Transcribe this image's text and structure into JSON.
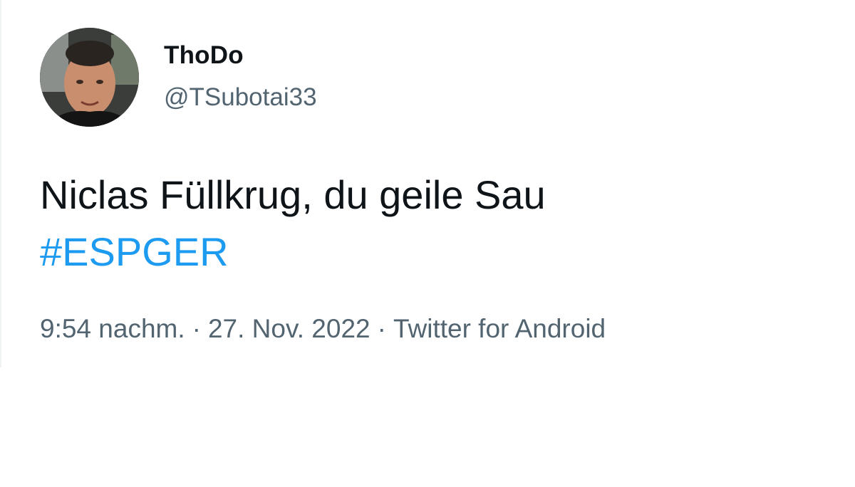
{
  "user": {
    "display_name": "ThoDo",
    "handle": "@TSubotai33"
  },
  "tweet": {
    "text": "Niclas Füllkrug, du geile Sau",
    "hashtag": "#ESPGER"
  },
  "meta": {
    "time": "9:54 nachm.",
    "separator": "·",
    "date": "27. Nov. 2022",
    "source": "Twitter for Android"
  },
  "colors": {
    "text_primary": "#0f1419",
    "text_secondary": "#536471",
    "hashtag": "#1d9bf0"
  }
}
